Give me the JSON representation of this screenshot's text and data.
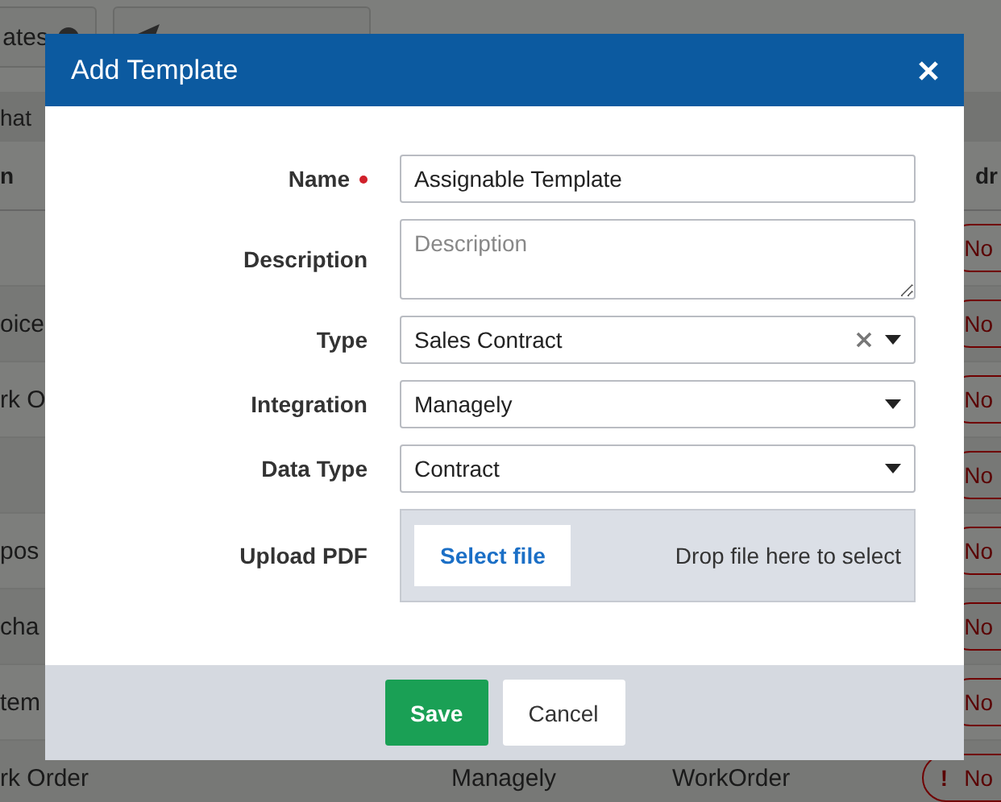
{
  "background": {
    "toolbar": [
      {
        "kind": "text",
        "label": "ates",
        "badge": true
      },
      {
        "kind": "icon"
      }
    ],
    "search": {
      "placeholder": "hat"
    },
    "table": {
      "columns": [
        "n",
        "dr"
      ],
      "rows": [
        {
          "column_1": "",
          "column_3": "",
          "column_4": "",
          "flag": "No"
        },
        {
          "column_1": "oice",
          "column_3": "",
          "column_4": "",
          "flag": "No"
        },
        {
          "column_1": "rk O",
          "column_3": "",
          "column_4": "",
          "flag": "No"
        },
        {
          "column_1": "",
          "column_3": "",
          "column_4": "",
          "flag": "No"
        },
        {
          "column_1": "pos",
          "column_3": "",
          "column_4": "",
          "flag": "No"
        },
        {
          "column_1": "cha",
          "column_3": "",
          "column_4": "",
          "flag": "No"
        },
        {
          "column_1": "tem",
          "column_3": "",
          "column_4": "",
          "flag": "No"
        },
        {
          "column_1": "rk Order",
          "column_3": "Managely",
          "column_4": "WorkOrder",
          "flag": "No",
          "icon": "!"
        }
      ]
    }
  },
  "dialog": {
    "title": "Add Template",
    "fields": [
      {
        "kind": "text",
        "label": "Name",
        "required": true,
        "value": "Assignable Template"
      },
      {
        "kind": "textarea",
        "label": "Description",
        "required": false,
        "placeholder": "Description"
      },
      {
        "kind": "select",
        "label": "Type",
        "required": false,
        "value": "Sales Contract",
        "clearable": true
      },
      {
        "kind": "select",
        "label": "Integration",
        "required": false,
        "value": "Managely",
        "clearable": false
      },
      {
        "kind": "select",
        "label": "Data Type",
        "required": false,
        "value": "Contract",
        "clearable": false
      },
      {
        "kind": "upload",
        "label": "Upload PDF",
        "required": false,
        "button": "Select file",
        "hint": "Drop file here to select"
      }
    ],
    "buttons": [
      {
        "label": "Save",
        "kind": "primary"
      },
      {
        "label": "Cancel",
        "kind": "secondary"
      }
    ]
  }
}
